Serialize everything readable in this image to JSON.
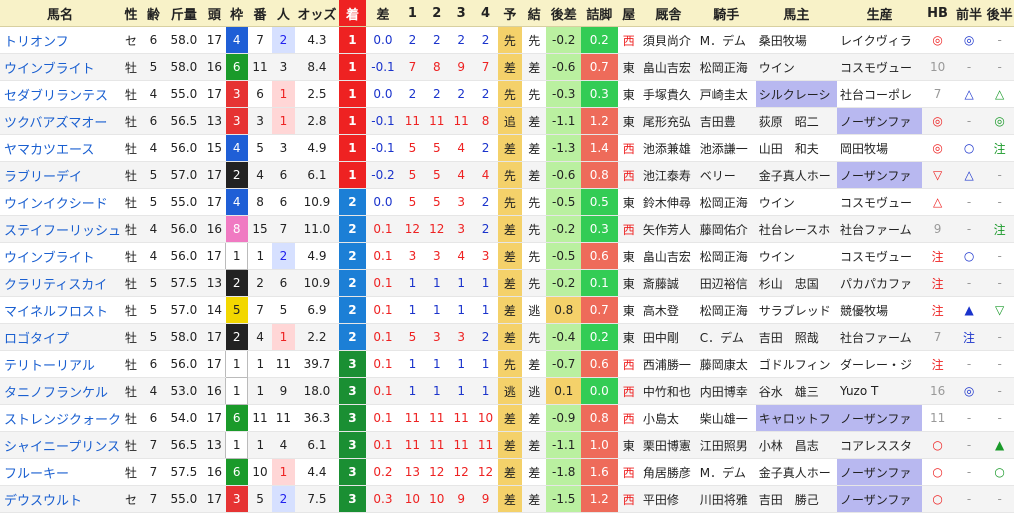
{
  "headers": [
    "馬名",
    "性",
    "齢",
    "斤量",
    "頭",
    "枠",
    "番",
    "人",
    "オッズ",
    "着",
    "差",
    "1",
    "2",
    "3",
    "4",
    "予",
    "結",
    "後差",
    "詰脚",
    "屋",
    "厩舎",
    "騎手",
    "馬主",
    "生産",
    "HB",
    "前半",
    "後半"
  ],
  "rows": [
    {
      "name": "トリオンフ",
      "sex": "セ",
      "age": "6",
      "weight": "58.0",
      "heads": "17",
      "waku": "4",
      "ban": "7",
      "pop": "2",
      "odds": "4.3",
      "chaku": "1",
      "diff": "0.0",
      "p1": "2",
      "p2": "2",
      "p3": "2",
      "p4": "2",
      "yo": "先",
      "ketsu": "先",
      "late": "-0.2",
      "sp": "0.2",
      "stable": "西",
      "trainer": "須貝尚介",
      "jockey": "М．デム",
      "owner": "桑田牧場",
      "breeder": "レイクヴィラ",
      "hb": "◎",
      "zen": "◎",
      "kou": "-"
    },
    {
      "name": "ウインブライト",
      "sex": "牡",
      "age": "5",
      "weight": "58.0",
      "heads": "16",
      "waku": "6",
      "ban": "11",
      "pop": "3",
      "odds": "8.4",
      "chaku": "1",
      "diff": "-0.1",
      "p1": "7",
      "p2": "8",
      "p3": "9",
      "p4": "7",
      "yo": "差",
      "ketsu": "差",
      "late": "-0.6",
      "sp": "0.7",
      "stable": "東",
      "trainer": "畠山吉宏",
      "jockey": "松岡正海",
      "owner": "ウイン",
      "breeder": "コスモヴュー",
      "hb": "10",
      "zen": "-",
      "kou": "-"
    },
    {
      "name": "セダブリランテス",
      "sex": "牡",
      "age": "4",
      "weight": "55.0",
      "heads": "17",
      "waku": "3",
      "ban": "6",
      "pop": "1",
      "odds": "2.5",
      "chaku": "1",
      "diff": "0.0",
      "p1": "2",
      "p2": "2",
      "p3": "2",
      "p4": "2",
      "yo": "先",
      "ketsu": "先",
      "late": "-0.3",
      "sp": "0.3",
      "stable": "東",
      "trainer": "手塚貴久",
      "jockey": "戸崎圭太",
      "owner": "シルクレーシ",
      "breeder": "社台コーポレ",
      "hb": "7",
      "zen": "△",
      "kou": "△"
    },
    {
      "name": "ツクバアズマオー",
      "sex": "牡",
      "age": "6",
      "weight": "56.5",
      "heads": "13",
      "waku": "3",
      "ban": "3",
      "pop": "1",
      "odds": "2.8",
      "chaku": "1",
      "diff": "-0.1",
      "p1": "11",
      "p2": "11",
      "p3": "11",
      "p4": "8",
      "yo": "追",
      "ketsu": "差",
      "late": "-1.1",
      "sp": "1.2",
      "stable": "東",
      "trainer": "尾形充弘",
      "jockey": "吉田豊",
      "owner": "荻原　昭二",
      "breeder": "ノーザンファ",
      "hb": "◎",
      "zen": "-",
      "kou": "◎"
    },
    {
      "name": "ヤマカツエース",
      "sex": "牡",
      "age": "4",
      "weight": "56.0",
      "heads": "15",
      "waku": "4",
      "ban": "5",
      "pop": "3",
      "odds": "4.9",
      "chaku": "1",
      "diff": "-0.1",
      "p1": "5",
      "p2": "5",
      "p3": "4",
      "p4": "2",
      "yo": "差",
      "ketsu": "差",
      "late": "-1.3",
      "sp": "1.4",
      "stable": "西",
      "trainer": "池添兼雄",
      "jockey": "池添謙一",
      "owner": "山田　和夫",
      "breeder": "岡田牧場",
      "hb": "◎",
      "zen": "○",
      "kou": "注"
    },
    {
      "name": "ラブリーデイ",
      "sex": "牡",
      "age": "5",
      "weight": "57.0",
      "heads": "17",
      "waku": "2",
      "ban": "4",
      "pop": "6",
      "odds": "6.1",
      "chaku": "1",
      "diff": "-0.2",
      "p1": "5",
      "p2": "5",
      "p3": "4",
      "p4": "4",
      "yo": "先",
      "ketsu": "差",
      "late": "-0.6",
      "sp": "0.8",
      "stable": "西",
      "trainer": "池江泰寿",
      "jockey": "ベリー",
      "owner": "金子真人ホー",
      "breeder": "ノーザンファ",
      "hb": "▽",
      "zen": "△",
      "kou": "-"
    },
    {
      "name": "ウインイクシード",
      "sex": "牡",
      "age": "5",
      "weight": "55.0",
      "heads": "17",
      "waku": "4",
      "ban": "8",
      "pop": "6",
      "odds": "10.9",
      "chaku": "2",
      "diff": "0.0",
      "p1": "5",
      "p2": "5",
      "p3": "3",
      "p4": "2",
      "yo": "先",
      "ketsu": "先",
      "late": "-0.5",
      "sp": "0.5",
      "stable": "東",
      "trainer": "鈴木伸尋",
      "jockey": "松岡正海",
      "owner": "ウイン",
      "breeder": "コスモヴュー",
      "hb": "△",
      "zen": "-",
      "kou": "-"
    },
    {
      "name": "ステイフーリッシュ",
      "sex": "牡",
      "age": "4",
      "weight": "56.0",
      "heads": "16",
      "waku": "8",
      "ban": "15",
      "pop": "7",
      "odds": "11.0",
      "chaku": "2",
      "diff": "0.1",
      "p1": "12",
      "p2": "12",
      "p3": "3",
      "p4": "2",
      "yo": "差",
      "ketsu": "先",
      "late": "-0.2",
      "sp": "0.3",
      "stable": "西",
      "trainer": "矢作芳人",
      "jockey": "藤岡佑介",
      "owner": "社台レースホ",
      "breeder": "社台ファーム",
      "hb": "9",
      "zen": "-",
      "kou": "注"
    },
    {
      "name": "ウインブライト",
      "sex": "牡",
      "age": "4",
      "weight": "56.0",
      "heads": "17",
      "waku": "1",
      "ban": "1",
      "pop": "2",
      "odds": "4.9",
      "chaku": "2",
      "diff": "0.1",
      "p1": "3",
      "p2": "3",
      "p3": "4",
      "p4": "3",
      "yo": "差",
      "ketsu": "先",
      "late": "-0.5",
      "sp": "0.6",
      "stable": "東",
      "trainer": "畠山吉宏",
      "jockey": "松岡正海",
      "owner": "ウイン",
      "breeder": "コスモヴュー",
      "hb": "注",
      "zen": "○",
      "kou": "-"
    },
    {
      "name": "クラリティスカイ",
      "sex": "牡",
      "age": "5",
      "weight": "57.5",
      "heads": "13",
      "waku": "2",
      "ban": "2",
      "pop": "6",
      "odds": "10.9",
      "chaku": "2",
      "diff": "0.1",
      "p1": "1",
      "p2": "1",
      "p3": "1",
      "p4": "1",
      "yo": "差",
      "ketsu": "先",
      "late": "-0.2",
      "sp": "0.1",
      "stable": "東",
      "trainer": "斎藤誠",
      "jockey": "田辺裕信",
      "owner": "杉山　忠国",
      "breeder": "パカパカファ",
      "hb": "注",
      "zen": "-",
      "kou": "-"
    },
    {
      "name": "マイネルフロスト",
      "sex": "牡",
      "age": "5",
      "weight": "57.0",
      "heads": "14",
      "waku": "5",
      "ban": "7",
      "pop": "5",
      "odds": "6.9",
      "chaku": "2",
      "diff": "0.1",
      "p1": "1",
      "p2": "1",
      "p3": "1",
      "p4": "1",
      "yo": "差",
      "ketsu": "逃",
      "late": "0.8",
      "sp": "0.7",
      "stable": "東",
      "trainer": "高木登",
      "jockey": "松岡正海",
      "owner": "サラブレッド",
      "breeder": "競優牧場",
      "hb": "注",
      "zen": "▲",
      "kou": "▽"
    },
    {
      "name": "ロゴタイプ",
      "sex": "牡",
      "age": "5",
      "weight": "58.0",
      "heads": "17",
      "waku": "2",
      "ban": "4",
      "pop": "1",
      "odds": "2.2",
      "chaku": "2",
      "diff": "0.1",
      "p1": "5",
      "p2": "3",
      "p3": "3",
      "p4": "2",
      "yo": "差",
      "ketsu": "先",
      "late": "-0.4",
      "sp": "0.2",
      "stable": "東",
      "trainer": "田中剛",
      "jockey": "C．デム",
      "owner": "吉田　照哉",
      "breeder": "社台ファーム",
      "hb": "7",
      "zen": "注",
      "kou": "-"
    },
    {
      "name": "テリトーリアル",
      "sex": "牡",
      "age": "6",
      "weight": "56.0",
      "heads": "17",
      "waku": "1",
      "ban": "1",
      "pop": "11",
      "odds": "39.7",
      "chaku": "3",
      "diff": "0.1",
      "p1": "1",
      "p2": "1",
      "p3": "1",
      "p4": "1",
      "yo": "先",
      "ketsu": "差",
      "late": "-0.7",
      "sp": "0.6",
      "stable": "西",
      "trainer": "西浦勝一",
      "jockey": "藤岡康太",
      "owner": "ゴドルフィン",
      "breeder": "ダーレー・ジ",
      "hb": "注",
      "zen": "-",
      "kou": "-"
    },
    {
      "name": "タニノフランケル",
      "sex": "牡",
      "age": "4",
      "weight": "53.0",
      "heads": "16",
      "waku": "1",
      "ban": "1",
      "pop": "9",
      "odds": "18.0",
      "chaku": "3",
      "diff": "0.1",
      "p1": "1",
      "p2": "1",
      "p3": "1",
      "p4": "1",
      "yo": "逃",
      "ketsu": "逃",
      "late": "0.1",
      "sp": "0.0",
      "stable": "西",
      "trainer": "中竹和也",
      "jockey": "内田博幸",
      "owner": "谷水　雄三",
      "breeder": "Yuzo T",
      "hb": "16",
      "zen": "◎",
      "kou": "-"
    },
    {
      "name": "ストレンジクォーク",
      "sex": "牡",
      "age": "6",
      "weight": "54.0",
      "heads": "17",
      "waku": "6",
      "ban": "11",
      "pop": "11",
      "odds": "36.3",
      "chaku": "3",
      "diff": "0.1",
      "p1": "11",
      "p2": "11",
      "p3": "11",
      "p4": "10",
      "yo": "差",
      "ketsu": "差",
      "late": "-0.9",
      "sp": "0.8",
      "stable": "西",
      "trainer": "小島太",
      "jockey": "柴山雄一",
      "owner": "キャロットフ",
      "breeder": "ノーザンファ",
      "hb": "11",
      "zen": "-",
      "kou": "-"
    },
    {
      "name": "シャイニープリンス",
      "sex": "牡",
      "age": "7",
      "weight": "56.5",
      "heads": "13",
      "waku": "1",
      "ban": "1",
      "pop": "4",
      "odds": "6.1",
      "chaku": "3",
      "diff": "0.1",
      "p1": "11",
      "p2": "11",
      "p3": "11",
      "p4": "11",
      "yo": "差",
      "ketsu": "差",
      "late": "-1.1",
      "sp": "1.0",
      "stable": "東",
      "trainer": "栗田博憲",
      "jockey": "江田照男",
      "owner": "小林　昌志",
      "breeder": "コアレススタ",
      "hb": "○",
      "zen": "-",
      "kou": "▲"
    },
    {
      "name": "フルーキー",
      "sex": "牡",
      "age": "7",
      "weight": "57.5",
      "heads": "16",
      "waku": "6",
      "ban": "10",
      "pop": "1",
      "odds": "4.4",
      "chaku": "3",
      "diff": "0.2",
      "p1": "13",
      "p2": "12",
      "p3": "12",
      "p4": "12",
      "yo": "差",
      "ketsu": "差",
      "late": "-1.8",
      "sp": "1.6",
      "stable": "西",
      "trainer": "角居勝彦",
      "jockey": "М．デム",
      "owner": "金子真人ホー",
      "breeder": "ノーザンファ",
      "hb": "○",
      "zen": "-",
      "kou": "○"
    },
    {
      "name": "デウスウルト",
      "sex": "セ",
      "age": "7",
      "weight": "55.0",
      "heads": "17",
      "waku": "3",
      "ban": "5",
      "pop": "2",
      "odds": "7.5",
      "chaku": "3",
      "diff": "0.3",
      "p1": "10",
      "p2": "10",
      "p3": "9",
      "p4": "9",
      "yo": "差",
      "ketsu": "差",
      "late": "-1.5",
      "sp": "1.2",
      "stable": "西",
      "trainer": "平田修",
      "jockey": "川田将雅",
      "owner": "吉田　勝己",
      "breeder": "ノーザンファ",
      "hb": "○",
      "zen": "-",
      "kou": "-"
    }
  ]
}
